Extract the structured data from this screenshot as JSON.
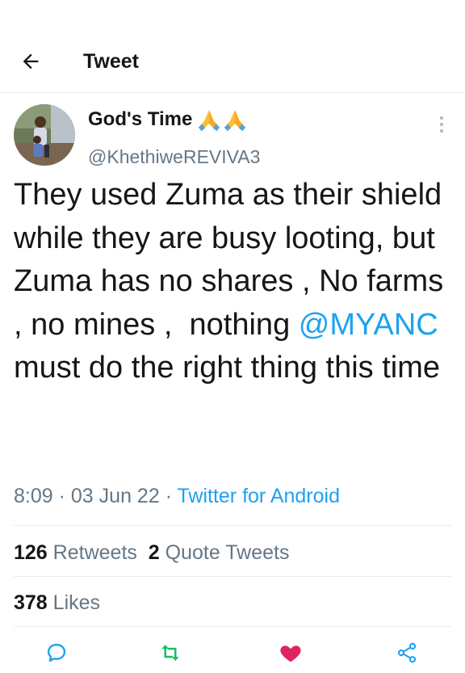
{
  "header": {
    "title": "Tweet",
    "back_icon": "arrow-left-icon"
  },
  "author": {
    "display_name": "God's Time",
    "name_emoji": "folded-hands-emoji",
    "handle": "@KhethiweREVIVA3"
  },
  "tweet": {
    "text_before_mention": "They used Zuma as their shield  while they are busy looting, but Zuma has no shares , No farms , no mines ,  nothing ",
    "mention": "@MYANC",
    "text_after_mention": "  must do the right thing this time",
    "time": "8:09",
    "separator": "·",
    "date": "03 Jun 22",
    "source": "Twitter for Android"
  },
  "stats": {
    "retweets_count": "126",
    "retweets_label": "Retweets",
    "quotes_count": "2",
    "quotes_label": "Quote Tweets",
    "likes_count": "378",
    "likes_label": "Likes"
  },
  "actions": {
    "reply_icon": "reply-icon",
    "retweet_icon": "retweet-icon",
    "like_icon": "heart-icon",
    "share_icon": "share-icon"
  },
  "colors": {
    "accent": "#1da1f2",
    "retweet": "#17bf63",
    "like": "#e0245e",
    "muted": "#657786"
  }
}
